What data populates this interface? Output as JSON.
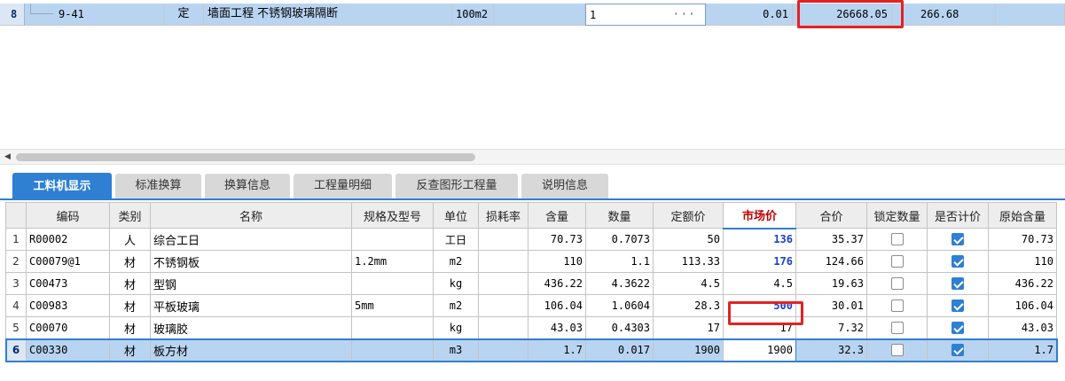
{
  "top_row": {
    "row_number": "8",
    "code": "9-41",
    "kind": "定",
    "name": "墙面工程 不锈钢玻璃隔断",
    "unit": "100m2",
    "quantity": "1",
    "quantity_button": "···",
    "unit_price": "0.01",
    "total": "26668.05",
    "amount": "266.68"
  },
  "tabs": [
    {
      "label": "工料机显示",
      "active": true
    },
    {
      "label": "标准换算",
      "active": false
    },
    {
      "label": "换算信息",
      "active": false
    },
    {
      "label": "工程量明细",
      "active": false
    },
    {
      "label": "反查图形工程量",
      "active": false
    },
    {
      "label": "说明信息",
      "active": false
    }
  ],
  "columns": [
    "编码",
    "类别",
    "名称",
    "规格及型号",
    "单位",
    "损耗率",
    "含量",
    "数量",
    "定额价",
    "市场价",
    "合价",
    "锁定数量",
    "是否计价",
    "原始含量"
  ],
  "rows": [
    {
      "idx": "1",
      "code": "R00002",
      "kind": "人",
      "name": "综合工日",
      "spec": "",
      "unit": "工日",
      "loss": "",
      "content": "70.73",
      "qty": "0.7073",
      "base_price": "50",
      "market_price": "136",
      "total": "35.37",
      "locked": false,
      "priced": true,
      "orig": "70.73"
    },
    {
      "idx": "2",
      "code": "C00079@1",
      "kind": "材",
      "name": "不锈钢板",
      "spec": "1.2mm",
      "unit": "m2",
      "loss": "",
      "content": "110",
      "qty": "1.1",
      "base_price": "113.33",
      "market_price": "176",
      "total": "124.66",
      "locked": false,
      "priced": true,
      "orig": "110"
    },
    {
      "idx": "3",
      "code": "C00473",
      "kind": "材",
      "name": "型钢",
      "spec": "",
      "unit": "kg",
      "loss": "",
      "content": "436.22",
      "qty": "4.3622",
      "base_price": "4.5",
      "market_price": "4.5",
      "total": "19.63",
      "locked": false,
      "priced": true,
      "orig": "436.22"
    },
    {
      "idx": "4",
      "code": "C00983",
      "kind": "材",
      "name": "平板玻璃",
      "spec": "5mm",
      "unit": "m2",
      "loss": "",
      "content": "106.04",
      "qty": "1.0604",
      "base_price": "28.3",
      "market_price": "500",
      "total": "30.01",
      "locked": false,
      "priced": true,
      "orig": "106.04"
    },
    {
      "idx": "5",
      "code": "C00070",
      "kind": "材",
      "name": "玻璃胶",
      "spec": "",
      "unit": "kg",
      "loss": "",
      "content": "43.03",
      "qty": "0.4303",
      "base_price": "17",
      "market_price": "17",
      "total": "7.32",
      "locked": false,
      "priced": true,
      "orig": "43.03"
    },
    {
      "idx": "6",
      "code": "C00330",
      "kind": "材",
      "name": "板方材",
      "spec": "",
      "unit": "m3",
      "loss": "",
      "content": "1.7",
      "qty": "0.017",
      "base_price": "1900",
      "market_price": "1900",
      "total": "32.3",
      "locked": false,
      "priced": true,
      "orig": "1.7"
    }
  ],
  "highlighted_market_rows": [
    0,
    1,
    3
  ],
  "selected_row": 5,
  "colors": {
    "accent": "#2f7fd3",
    "selection": "#b8d4f1",
    "highlight_box": "#e32222",
    "market_header": "#c00000",
    "market_value": "#1a3fd1"
  }
}
